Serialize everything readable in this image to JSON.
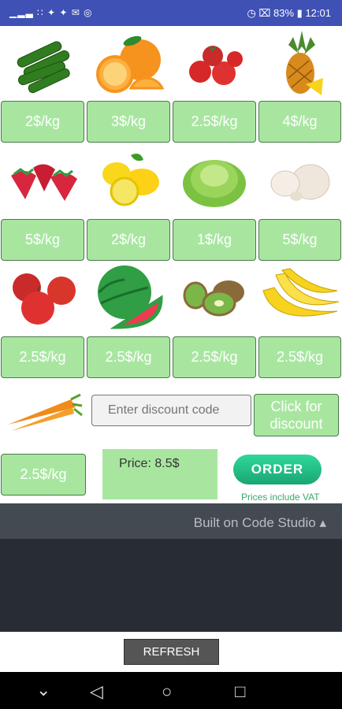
{
  "status": {
    "left": "▁▂▃ ∷ ✦ ✦ ✉ ◎",
    "battery": "83%",
    "time": "12:01"
  },
  "products": [
    {
      "name": "cucumber",
      "price": "2$/kg"
    },
    {
      "name": "orange",
      "price": "3$/kg"
    },
    {
      "name": "tomato",
      "price": "2.5$/kg"
    },
    {
      "name": "pineapple",
      "price": "4$/kg"
    },
    {
      "name": "strawberry",
      "price": "5$/kg"
    },
    {
      "name": "lemon",
      "price": "2$/kg"
    },
    {
      "name": "lettuce",
      "price": "1$/kg"
    },
    {
      "name": "garlic",
      "price": "5$/kg"
    },
    {
      "name": "apple",
      "price": "2.5$/kg"
    },
    {
      "name": "watermelon",
      "price": "2.5$/kg"
    },
    {
      "name": "kiwi",
      "price": "2.5$/kg"
    },
    {
      "name": "banana",
      "price": "2.5$/kg"
    },
    {
      "name": "carrot",
      "price": "2.5$/kg"
    }
  ],
  "discount": {
    "placeholder": "Enter discount code",
    "button": "Click for discount"
  },
  "order": {
    "price": "Price: 8.5$",
    "button": "ORDER",
    "vat": "Prices include VAT"
  },
  "footer": {
    "built": "Built on Code Studio ▴",
    "refresh": "REFRESH"
  },
  "colors": {
    "price_bg": "#a8e6a0",
    "status_bar": "#3f51b5",
    "order_button": "#1fc184"
  }
}
